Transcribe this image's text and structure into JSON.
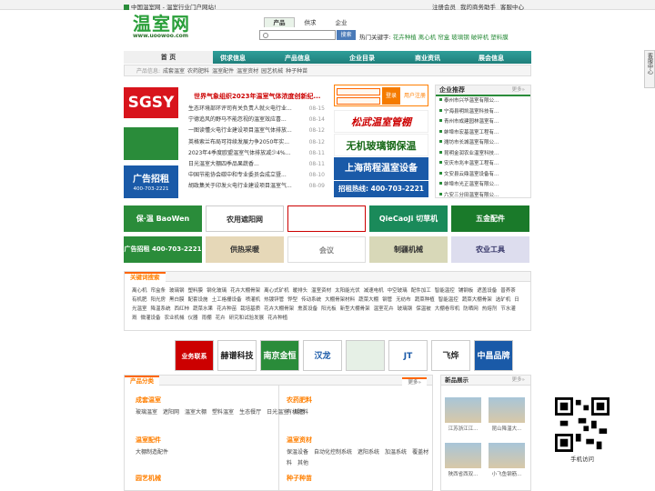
{
  "topbar": {
    "home_text": "中国温室网 - 温室行业门户网站!",
    "links": [
      "注册会员",
      "我的商务助手",
      "客服中心"
    ]
  },
  "logo": {
    "name": "温室网",
    "url": "www.uoowoo.com"
  },
  "search": {
    "tabs": [
      "产品",
      "供求",
      "企业"
    ],
    "placeholder": "",
    "button": "搜索",
    "hot_label": "热门关键字:",
    "hot_words": [
      "花卉种植",
      "离心机",
      "帘盒",
      "玻璃钢",
      "破碎机",
      "塑料膜"
    ]
  },
  "nav": [
    "首 页",
    "供求信息",
    "产品信息",
    "企业目录",
    "商业资讯",
    "展会信息"
  ],
  "subnav": {
    "prefix": "产品信息:",
    "items": [
      "成套温室",
      "农药肥料",
      "温室配件",
      "温室资材",
      "园艺机械",
      "种子种苗"
    ]
  },
  "banner": {
    "sgsy": "SGSY",
    "ad_title": "广告招租",
    "ad_phone": "400-703-2221"
  },
  "headline": "世界气象组织2023年温室气体浓度创新纪...",
  "news": [
    {
      "title": "生态环境部环评司有关负责人就火电行业...",
      "date": "08-15"
    },
    {
      "title": "宁德追风的野马不能忽视的温室效应喜...",
      "date": "08-14"
    },
    {
      "title": "一图读懂火电行业建设项目温室气体排放...",
      "date": "08-12"
    },
    {
      "title": "英格索兰布局可持续发展力争2050年实...",
      "date": "08-12"
    },
    {
      "title": "2023年4季度欧盟温室气体排放减少4%...",
      "date": "08-11"
    },
    {
      "title": "日光温室大棚四季品果蔬香...",
      "date": "08-11"
    },
    {
      "title": "中国节能协会碳中和专业委员会成立暨...",
      "date": "08-10"
    },
    {
      "title": "胡政集关于印发火电行业建设项目温室气...",
      "date": "08-09"
    }
  ],
  "login": {
    "button": "登录",
    "register": "用户注册"
  },
  "ads": {
    "ad1": "松武温室管棚",
    "ad2": "无机玻璃钢保温",
    "ad3": "上海苘程温室设备",
    "ad4": "招租热线: 400-703-2221"
  },
  "corp": {
    "title": "企业推荐",
    "more": "更多»",
    "items": [
      "泰州市兴华温室有限公...",
      "宁海县明凯温室科技有...",
      "青州市成建园林温室有...",
      "蚌埠市宏基温室工程有...",
      "潍坊市长城温室有限公...",
      "昆明金润农业温室科技...",
      "安庆市兆丰温室工程有...",
      "文安县云鼎温室设备有...",
      "蚌埠市光正温室有限公...",
      "六安三分田温室有限公..."
    ]
  },
  "grid": [
    "保·温 BaoWen",
    "农用遮阳网",
    "",
    "QieCaoJi 切草机",
    "五金配件",
    "广告招租 400-703-2221",
    "供热采暖",
    "会议",
    "制疆机械",
    "农业工具"
  ],
  "keywords": {
    "title": "关键词搜索",
    "words": [
      "离心机",
      "帘盒条",
      "玻璃钢",
      "塑料膜",
      "钢化玻璃",
      "花卉大棚骨架",
      "离心式矿机",
      "暖排头",
      "温室资材",
      "太阳能光伏",
      "减速电机",
      "中空玻璃",
      "配件加工",
      "智能温控",
      "铺钢板",
      "遮盖设备",
      "普养茶",
      "有机肥",
      "阳光房",
      "黑白膜",
      "配套设施",
      "土工格栅设备",
      "喷灌机",
      "热镀锌管",
      "铧型",
      "传动系统",
      "大棚骨架材料",
      "蔬菜大棚",
      "钢管",
      "无纺布",
      "蔬菜种植",
      "智能温控",
      "蔬菜大棚骨架",
      "选矿机",
      "日光温室",
      "降温系统",
      "西红柿",
      "蔬菜水果",
      "花卉种苗",
      "栽培基质",
      "花卉大棚骨架",
      "熏蒸设备",
      "阳光板",
      "新型大棚骨架",
      "温室花卉",
      "玻璃钢",
      "保温被",
      "大棚卷帘机",
      "防晒网",
      "热熔剂",
      "节水灌溉",
      "微灌设备",
      "农业机械",
      "仪器",
      "雨棚",
      "花卉",
      "研究和试验发展",
      "花卉种植"
    ]
  },
  "logos": [
    "业务联系",
    "赫谱科技",
    "南京金恒",
    "汉龙",
    "",
    "JT",
    "飞烨",
    "中昌品牌"
  ],
  "cat": {
    "title": "产品分类",
    "more": "更多»",
    "sections": [
      {
        "title": "成套温室",
        "items": [
          "玻璃温室",
          "遮阳网",
          "温室大棚",
          "塑料温室",
          "生态餐厅",
          "日光温室",
          "其他"
        ]
      },
      {
        "title": "农药肥料",
        "items": [
          "有机肥料"
        ]
      },
      {
        "title": "温室配件",
        "items": [
          "大棚制造配件"
        ]
      },
      {
        "title": "温室资材",
        "items": [
          "保温设备",
          "自动化控制系统",
          "遮阳系统",
          "加温系统",
          "覆盖材料",
          "其他"
        ]
      },
      {
        "title": "园艺机械",
        "items": []
      },
      {
        "title": "种子种苗",
        "items": []
      }
    ]
  },
  "newp": {
    "title": "新品展示",
    "more": "更多»",
    "captions": [
      "江苏浙江江...",
      "昆山降温大...",
      "陕西省西双...",
      "小飞鱼钢筋..."
    ]
  },
  "qr": {
    "caption": "手机访问"
  },
  "side": {
    "label": "客服中心"
  },
  "colors": {
    "brand": "#2a9f3a",
    "nav": "#1f7f7b",
    "accent": "#ff7f00",
    "red": "#d8141c",
    "blue": "#1a5aa8"
  }
}
